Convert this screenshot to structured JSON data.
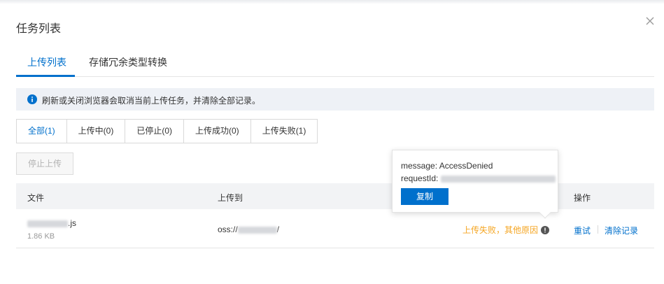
{
  "dialog": {
    "title": "任务列表"
  },
  "tabs": [
    {
      "label": "上传列表",
      "active": true
    },
    {
      "label": "存储冗余类型转换",
      "active": false
    }
  ],
  "notice": {
    "text": "刷新或关闭浏览器会取消当前上传任务，并清除全部记录。"
  },
  "filters": [
    {
      "label": "全部(1)",
      "active": true
    },
    {
      "label": "上传中(0)",
      "active": false
    },
    {
      "label": "已停止(0)",
      "active": false
    },
    {
      "label": "上传成功(0)",
      "active": false
    },
    {
      "label": "上传失败(1)",
      "active": false
    }
  ],
  "toolbar": {
    "stop_label": "停止上传"
  },
  "table": {
    "headers": {
      "file": "文件",
      "dest": "上传到",
      "actions": "操作"
    },
    "rows": [
      {
        "file_suffix": ".js",
        "size": "1.86 KB",
        "dest_prefix": "oss://",
        "dest_suffix": "/",
        "status": "上传失败，其他原因",
        "retry": "重试",
        "clear": "清除记录"
      }
    ]
  },
  "popover": {
    "message": "message: AccessDenied",
    "request_id_label": "requestId:",
    "copy_label": "复制"
  },
  "colors": {
    "accent": "#0070cc",
    "warning": "#f5a623"
  }
}
